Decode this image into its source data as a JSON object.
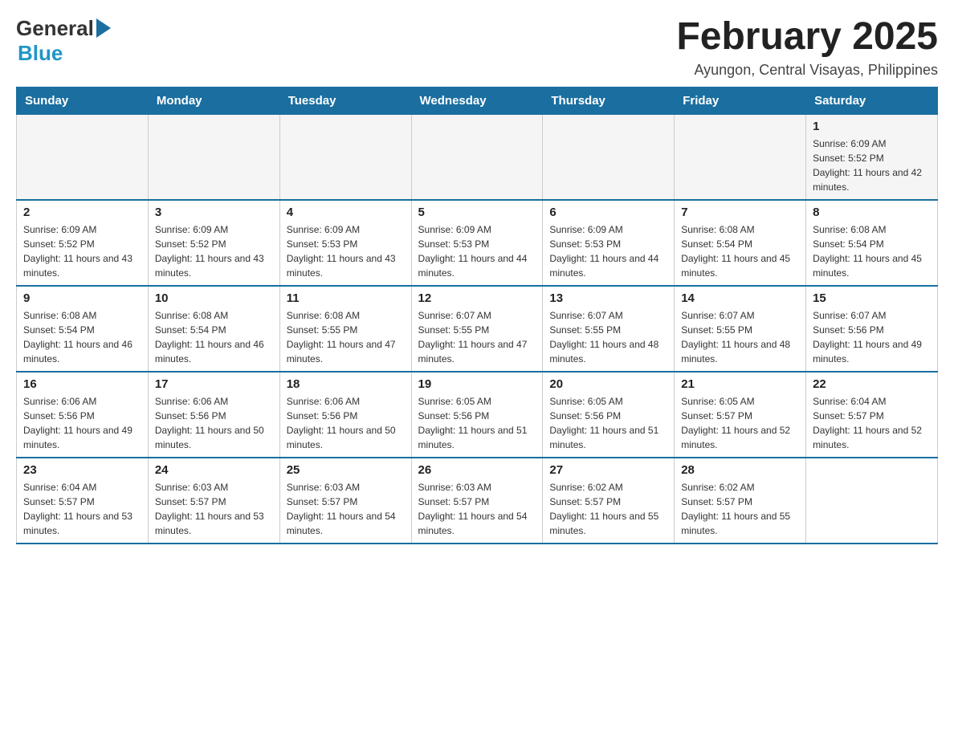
{
  "header": {
    "logo_general": "General",
    "logo_blue": "Blue",
    "month_title": "February 2025",
    "location": "Ayungon, Central Visayas, Philippines"
  },
  "days_of_week": [
    "Sunday",
    "Monday",
    "Tuesday",
    "Wednesday",
    "Thursday",
    "Friday",
    "Saturday"
  ],
  "weeks": [
    {
      "days": [
        {
          "num": "",
          "info": ""
        },
        {
          "num": "",
          "info": ""
        },
        {
          "num": "",
          "info": ""
        },
        {
          "num": "",
          "info": ""
        },
        {
          "num": "",
          "info": ""
        },
        {
          "num": "",
          "info": ""
        },
        {
          "num": "1",
          "info": "Sunrise: 6:09 AM\nSunset: 5:52 PM\nDaylight: 11 hours and 42 minutes."
        }
      ]
    },
    {
      "days": [
        {
          "num": "2",
          "info": "Sunrise: 6:09 AM\nSunset: 5:52 PM\nDaylight: 11 hours and 43 minutes."
        },
        {
          "num": "3",
          "info": "Sunrise: 6:09 AM\nSunset: 5:52 PM\nDaylight: 11 hours and 43 minutes."
        },
        {
          "num": "4",
          "info": "Sunrise: 6:09 AM\nSunset: 5:53 PM\nDaylight: 11 hours and 43 minutes."
        },
        {
          "num": "5",
          "info": "Sunrise: 6:09 AM\nSunset: 5:53 PM\nDaylight: 11 hours and 44 minutes."
        },
        {
          "num": "6",
          "info": "Sunrise: 6:09 AM\nSunset: 5:53 PM\nDaylight: 11 hours and 44 minutes."
        },
        {
          "num": "7",
          "info": "Sunrise: 6:08 AM\nSunset: 5:54 PM\nDaylight: 11 hours and 45 minutes."
        },
        {
          "num": "8",
          "info": "Sunrise: 6:08 AM\nSunset: 5:54 PM\nDaylight: 11 hours and 45 minutes."
        }
      ]
    },
    {
      "days": [
        {
          "num": "9",
          "info": "Sunrise: 6:08 AM\nSunset: 5:54 PM\nDaylight: 11 hours and 46 minutes."
        },
        {
          "num": "10",
          "info": "Sunrise: 6:08 AM\nSunset: 5:54 PM\nDaylight: 11 hours and 46 minutes."
        },
        {
          "num": "11",
          "info": "Sunrise: 6:08 AM\nSunset: 5:55 PM\nDaylight: 11 hours and 47 minutes."
        },
        {
          "num": "12",
          "info": "Sunrise: 6:07 AM\nSunset: 5:55 PM\nDaylight: 11 hours and 47 minutes."
        },
        {
          "num": "13",
          "info": "Sunrise: 6:07 AM\nSunset: 5:55 PM\nDaylight: 11 hours and 48 minutes."
        },
        {
          "num": "14",
          "info": "Sunrise: 6:07 AM\nSunset: 5:55 PM\nDaylight: 11 hours and 48 minutes."
        },
        {
          "num": "15",
          "info": "Sunrise: 6:07 AM\nSunset: 5:56 PM\nDaylight: 11 hours and 49 minutes."
        }
      ]
    },
    {
      "days": [
        {
          "num": "16",
          "info": "Sunrise: 6:06 AM\nSunset: 5:56 PM\nDaylight: 11 hours and 49 minutes."
        },
        {
          "num": "17",
          "info": "Sunrise: 6:06 AM\nSunset: 5:56 PM\nDaylight: 11 hours and 50 minutes."
        },
        {
          "num": "18",
          "info": "Sunrise: 6:06 AM\nSunset: 5:56 PM\nDaylight: 11 hours and 50 minutes."
        },
        {
          "num": "19",
          "info": "Sunrise: 6:05 AM\nSunset: 5:56 PM\nDaylight: 11 hours and 51 minutes."
        },
        {
          "num": "20",
          "info": "Sunrise: 6:05 AM\nSunset: 5:56 PM\nDaylight: 11 hours and 51 minutes."
        },
        {
          "num": "21",
          "info": "Sunrise: 6:05 AM\nSunset: 5:57 PM\nDaylight: 11 hours and 52 minutes."
        },
        {
          "num": "22",
          "info": "Sunrise: 6:04 AM\nSunset: 5:57 PM\nDaylight: 11 hours and 52 minutes."
        }
      ]
    },
    {
      "days": [
        {
          "num": "23",
          "info": "Sunrise: 6:04 AM\nSunset: 5:57 PM\nDaylight: 11 hours and 53 minutes."
        },
        {
          "num": "24",
          "info": "Sunrise: 6:03 AM\nSunset: 5:57 PM\nDaylight: 11 hours and 53 minutes."
        },
        {
          "num": "25",
          "info": "Sunrise: 6:03 AM\nSunset: 5:57 PM\nDaylight: 11 hours and 54 minutes."
        },
        {
          "num": "26",
          "info": "Sunrise: 6:03 AM\nSunset: 5:57 PM\nDaylight: 11 hours and 54 minutes."
        },
        {
          "num": "27",
          "info": "Sunrise: 6:02 AM\nSunset: 5:57 PM\nDaylight: 11 hours and 55 minutes."
        },
        {
          "num": "28",
          "info": "Sunrise: 6:02 AM\nSunset: 5:57 PM\nDaylight: 11 hours and 55 minutes."
        },
        {
          "num": "",
          "info": ""
        }
      ]
    }
  ]
}
